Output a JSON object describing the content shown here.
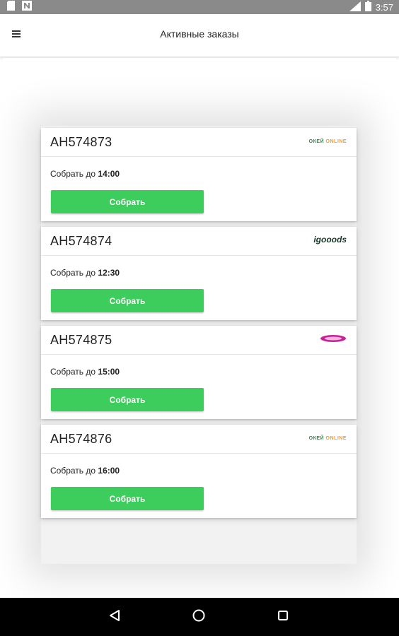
{
  "status_bar": {
    "time": "3:57",
    "left_icons": [
      "file-icon",
      "n-icon"
    ],
    "right_icons": [
      "signal-icon",
      "battery-icon"
    ]
  },
  "app_bar": {
    "title": "Активные заказы",
    "menu_icon": "menu-icon"
  },
  "orders": [
    {
      "id": "АН574873",
      "deadline_label": "Собрать до",
      "deadline_time": "14:00",
      "button_label": "Собрать",
      "store_logo": "okey-logo"
    },
    {
      "id": "АН574874",
      "deadline_label": "Собрать до",
      "deadline_time": "12:30",
      "button_label": "Собрать",
      "store_logo": "igooods-logo",
      "logo_text": "igooods"
    },
    {
      "id": "АН574875",
      "deadline_label": "Собрать до",
      "deadline_time": "15:00",
      "button_label": "Собрать",
      "store_logo": "utkonos-logo"
    },
    {
      "id": "АН574876",
      "deadline_label": "Собрать до",
      "deadline_time": "16:00",
      "button_label": "Собрать",
      "store_logo": "okey-logo"
    }
  ],
  "colors": {
    "accent_green": "#3ccd5d",
    "status_bar": "#8a8a8a",
    "nav_bar": "#000000"
  },
  "nav_bar": {
    "icons": [
      "back-icon",
      "home-icon",
      "recents-icon"
    ]
  }
}
